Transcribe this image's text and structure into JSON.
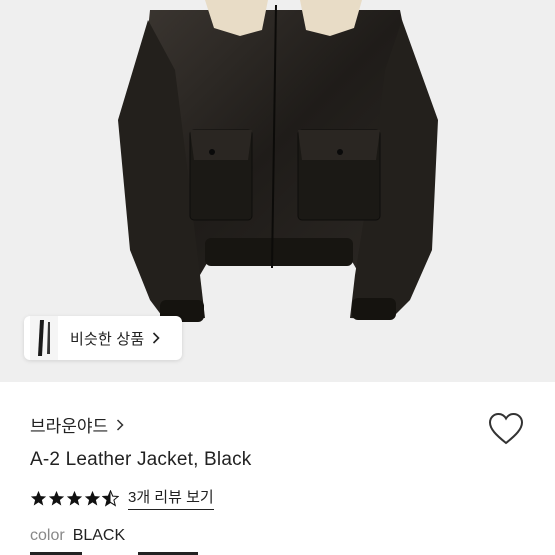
{
  "similar": {
    "label": "비슷한 상품",
    "chevron_icon": "chevron-right-icon"
  },
  "product": {
    "brand": "브라운야드",
    "title": "A-2 Leather Jacket, Black",
    "rating": 4.5,
    "review_link": "3개 리뷰 보기",
    "color_label": "color",
    "color_value": "BLACK"
  },
  "icons": {
    "wishlist": "heart-outline-icon",
    "star": "star-icon"
  },
  "colors": {
    "text": "#222222",
    "muted": "#888888",
    "hero_bg": "#efefef",
    "star": "#111111"
  }
}
